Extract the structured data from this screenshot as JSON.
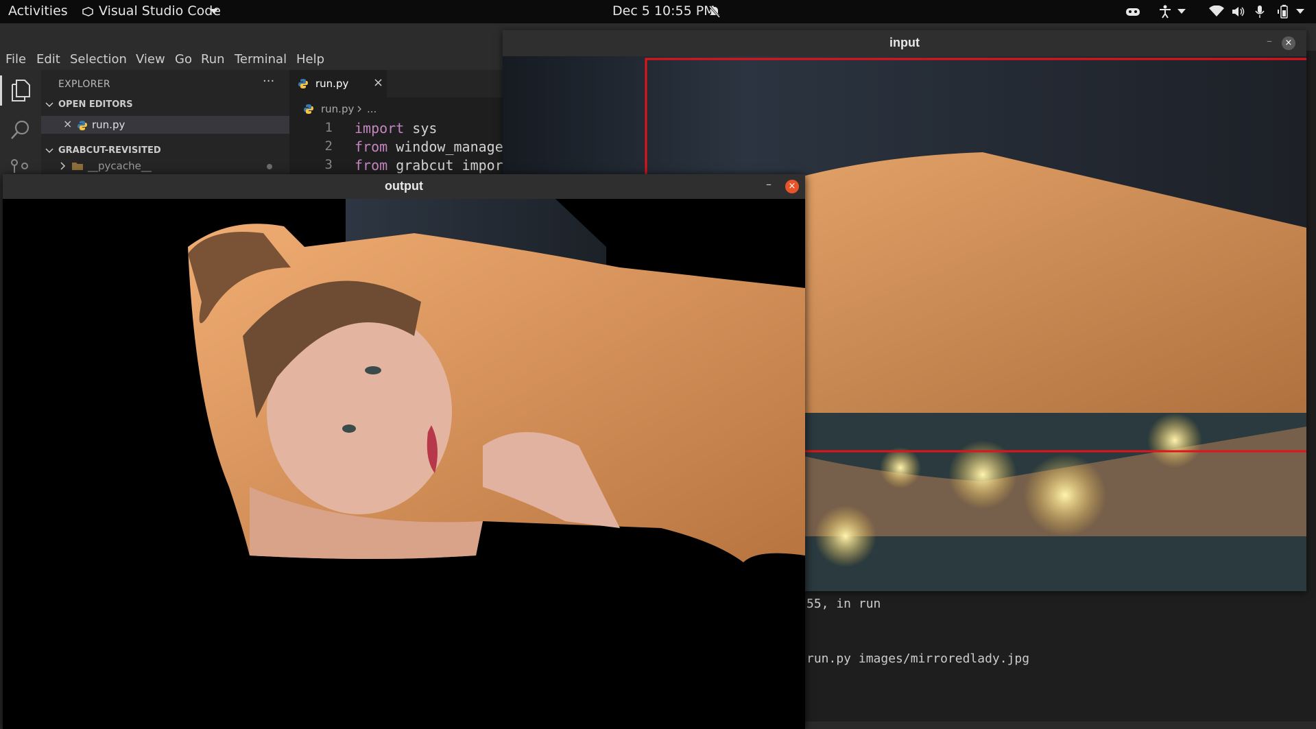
{
  "topbar": {
    "activities": "Activities",
    "app_name": "Visual Studio Code",
    "datetime": "Dec 5  10:55 PM"
  },
  "menu": [
    "File",
    "Edit",
    "Selection",
    "View",
    "Go",
    "Run",
    "Terminal",
    "Help"
  ],
  "explorer": {
    "title": "EXPLORER",
    "more": "···",
    "open_editors": "OPEN EDITORS",
    "open_file": "run.py",
    "project": "GRABCUT-REVISITED",
    "folder": "__pycache__"
  },
  "editor": {
    "tab": "run.py",
    "breadcrumb_file": "run.py",
    "breadcrumb_more": "...",
    "lines": [
      {
        "n": "1",
        "kw": "import",
        "rest": " sys"
      },
      {
        "n": "2",
        "kw": "from",
        "rest": " window_manage"
      },
      {
        "n": "3",
        "kw": "from",
        "rest": " grabcut impor"
      }
    ]
  },
  "terminal": {
    "line1": "55, in run",
    "line2": "run.py images/mirroredlady.jpg"
  },
  "windows": {
    "input_title": "input",
    "output_title": "output",
    "minimize": "–",
    "close": "×"
  },
  "colors": {
    "selection_rect": "#e0141a",
    "close_orange": "#e8542a"
  }
}
